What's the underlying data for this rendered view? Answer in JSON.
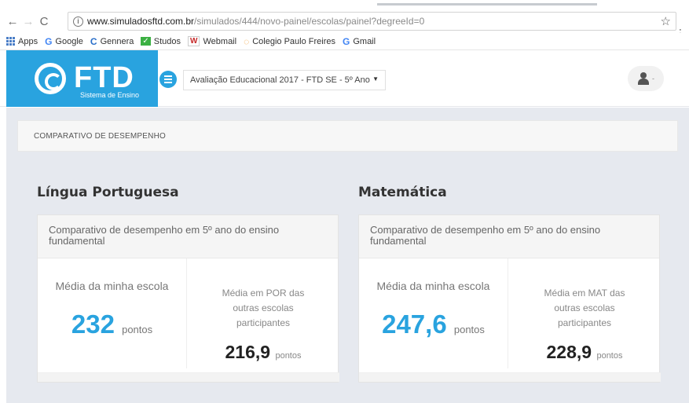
{
  "browser": {
    "url_host": "www.simuladosftd.com.br",
    "url_path": "/simulados/444/novo-painel/escolas/painel?degreeId=0",
    "bookmarks": [
      "Apps",
      "Google",
      "Gennera",
      "Studos",
      "Webmail",
      "Colegio Paulo Freires",
      "Gmail"
    ]
  },
  "header": {
    "logo_text": "FTD",
    "logo_subtitle": "Sistema de Ensino",
    "exam_selected": "Avaliação Educacional 2017 - FTD SE - 5º Ano",
    "brand_color": "#29a3df"
  },
  "section": {
    "title": "COMPARATIVO DE DESEMPENHO"
  },
  "subjects": [
    {
      "title": "Língua Portuguesa",
      "card_heading": "Comparativo de desempenho em 5º ano do ensino fundamental",
      "my_school_label": "Média da minha escola",
      "my_school_value": "232",
      "my_school_unit": "pontos",
      "others_label": "Média em POR das outras escolas participantes",
      "others_value": "216,9",
      "others_unit": "pontos"
    },
    {
      "title": "Matemática",
      "card_heading": "Comparativo de desempenho em 5º ano do ensino fundamental",
      "my_school_label": "Média da minha escola",
      "my_school_value": "247,6",
      "my_school_unit": "pontos",
      "others_label": "Média em MAT das outras escolas participantes",
      "others_value": "228,9",
      "others_unit": "pontos"
    }
  ]
}
